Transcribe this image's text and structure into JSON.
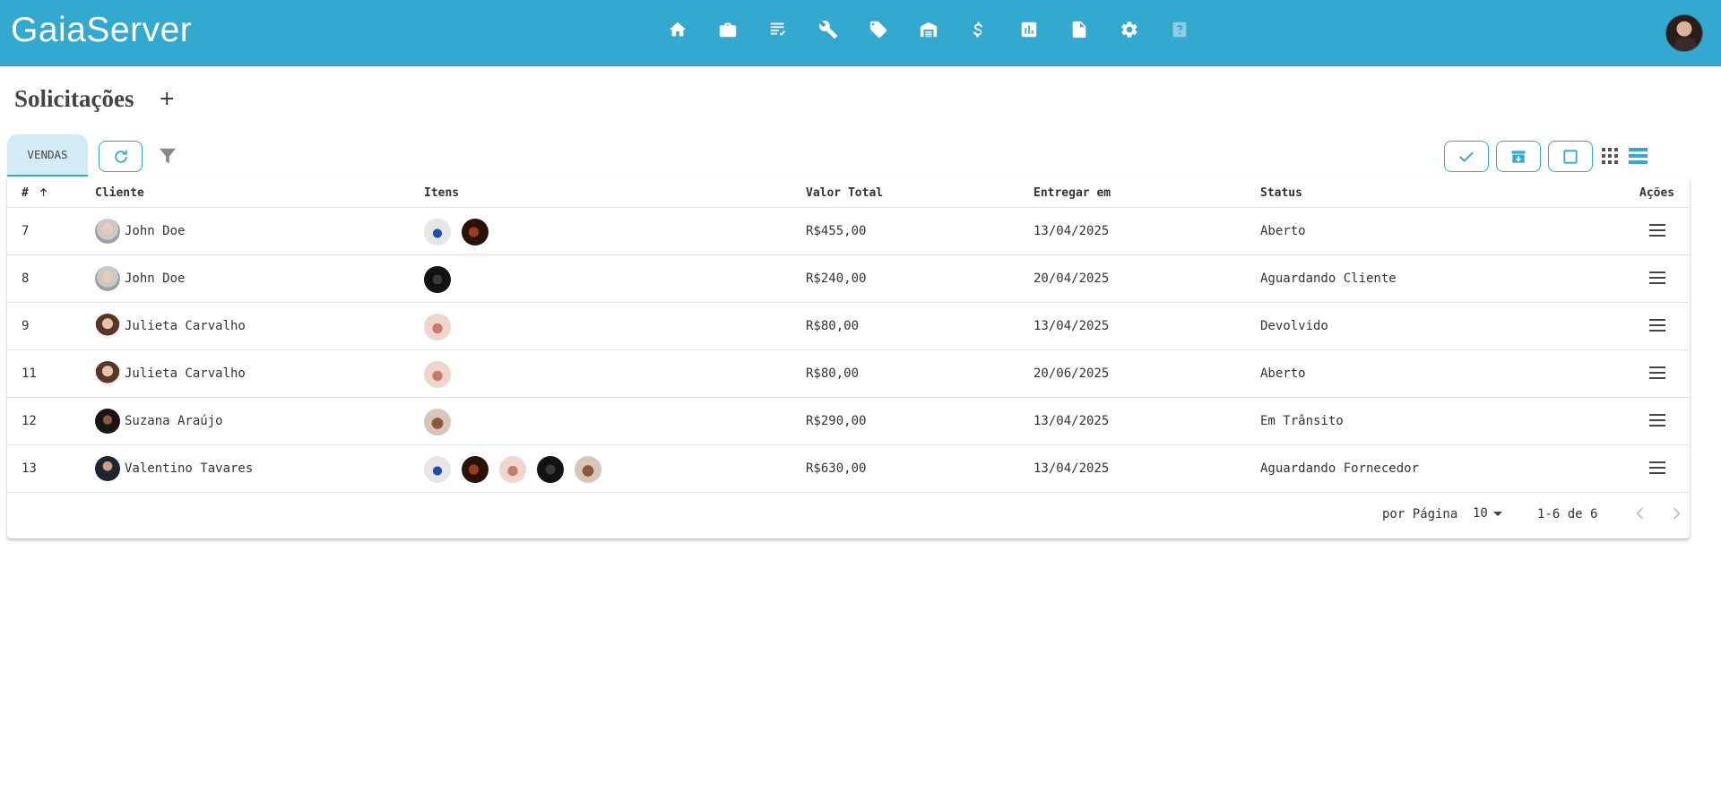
{
  "app": {
    "brand": "GaiaServer"
  },
  "nav": [
    {
      "icon": "home-icon"
    },
    {
      "icon": "briefcase-icon"
    },
    {
      "icon": "checklist-icon"
    },
    {
      "icon": "wrench-icon"
    },
    {
      "icon": "tag-icon"
    },
    {
      "icon": "warehouse-icon"
    },
    {
      "icon": "dollar-icon"
    },
    {
      "icon": "chart-icon"
    },
    {
      "icon": "document-icon"
    },
    {
      "icon": "gear-icon"
    },
    {
      "icon": "help-icon"
    }
  ],
  "page": {
    "title": "Solicitações",
    "add_label": "+"
  },
  "tabs": {
    "vendas": "VENDAS"
  },
  "table": {
    "headers": {
      "id": "#",
      "client": "Cliente",
      "items": "Itens",
      "total": "Valor Total",
      "deliver": "Entregar em",
      "status": "Status",
      "actions": "Ações"
    },
    "rows": [
      {
        "id": "7",
        "client": "John Doe",
        "total": "R$455,00",
        "deliver": "13/04/2025",
        "status": "Aberto"
      },
      {
        "id": "8",
        "client": "John Doe",
        "total": "R$240,00",
        "deliver": "20/04/2025",
        "status": "Aguardando Cliente"
      },
      {
        "id": "9",
        "client": "Julieta Carvalho",
        "total": "R$80,00",
        "deliver": "13/04/2025",
        "status": "Devolvido"
      },
      {
        "id": "11",
        "client": "Julieta Carvalho",
        "total": "R$80,00",
        "deliver": "20/06/2025",
        "status": "Aberto"
      },
      {
        "id": "12",
        "client": "Suzana Araújo",
        "total": "R$290,00",
        "deliver": "13/04/2025",
        "status": "Em Trânsito"
      },
      {
        "id": "13",
        "client": "Valentino Tavares",
        "total": "R$630,00",
        "deliver": "13/04/2025",
        "status": "Aguardando Fornecedor"
      }
    ]
  },
  "pagination": {
    "per_page_label": "por Página",
    "per_page_value": "10",
    "range": "1-6 de 6"
  },
  "colors": {
    "primary": "#33a9cf",
    "tab_bg": "#d3ebf4"
  }
}
